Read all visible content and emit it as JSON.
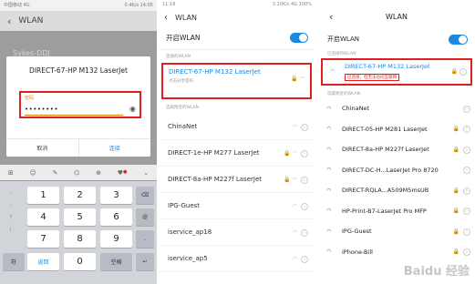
{
  "panel1": {
    "status_left": "中国移动 4G",
    "status_right": "0.4K/s  14:05",
    "title": "WLAN",
    "bg_network": "Sykes-DDJ",
    "dialog": {
      "title": "DIRECT-67-HP M132 LaserJet",
      "password_label": "密码",
      "password_value": "••••••••",
      "cancel": "取消",
      "connect": "连接"
    },
    "toolbar": [
      "⊞",
      "☺",
      "✎",
      "⌬",
      "⊕",
      "♥",
      "⌄"
    ],
    "side_keys": [
      "，",
      "。",
      "？",
      "！"
    ],
    "keys": {
      "r1": [
        "1",
        "2",
        "3"
      ],
      "r2": [
        "4",
        "5",
        "6"
      ],
      "r3": [
        "7",
        "8",
        "9"
      ],
      "delete": "⌫",
      "at": "@",
      "dot": ".",
      "symbols": "符",
      "return": "返回",
      "zero": "0",
      "space": "空格",
      "enter": "↵"
    }
  },
  "panel2": {
    "status_left": "11:18",
    "status_right": "3.20K/s  4G  100%",
    "title": "WLAN",
    "wlan_toggle_label": "开启WLAN",
    "connected_section": "连接的WLAN",
    "connected": {
      "ssid": "DIRECT-67-HP M132 LaserJet",
      "status": "点击分享密码"
    },
    "other_section": "选取附近的WLAN",
    "networks": [
      "ChinaNet",
      "DIRECT-1e-HP M277 LaserJet",
      "DIRECT-8a-HP M227f LaserJet",
      "IPG-Guest",
      "iservice_ap18",
      "iservice_ap5"
    ]
  },
  "panel3": {
    "title": "WLAN",
    "wlan_toggle_label": "开启WLAN",
    "connected_section": "已连接的WLAN",
    "connected": {
      "ssid": "DIRECT-67-HP M132 LaserJet",
      "status": "已连接，但无法访问互联网"
    },
    "other_section": "选取附近的WLAN",
    "networks": [
      "ChinaNet",
      "DIRECT-05-HP M281 LaserJet",
      "DIRECT-8a-HP M227f LaserJet",
      "DIRECT-DC-H...LaserJet Pro 8720",
      "DIRECT-RQLA...A509M5msUB",
      "HP-Print-B7-LaserJet Pro MFP",
      "IPG-Guest",
      "iPhone-Bill"
    ],
    "watermark": "Baidu 经验"
  },
  "colors": {
    "accent": "#1a88e0",
    "highlight": "#e02020",
    "orange": "#f08a00"
  }
}
